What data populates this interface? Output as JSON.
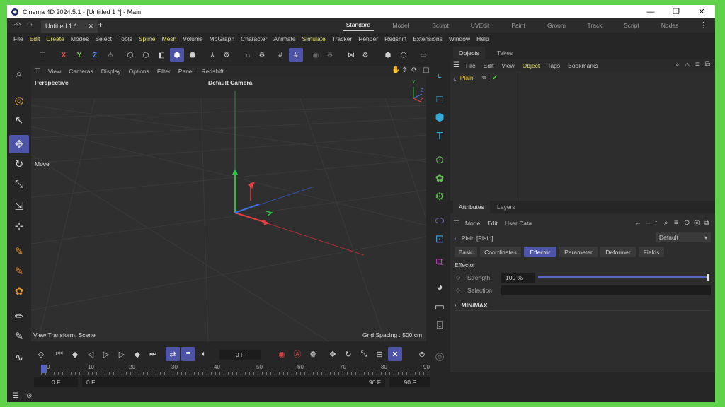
{
  "window": {
    "title": "Cinema 4D 2024.5.1 - [Untitled 1 *] - Main",
    "controls": {
      "minimize": "—",
      "maximize": "❐",
      "close": "✕"
    }
  },
  "tabs": {
    "doc_tab": "Untitled 1 *",
    "close": "✕",
    "add": "+",
    "layouts": [
      "Standard",
      "Model",
      "Sculpt",
      "UVEdit",
      "Paint",
      "Groom",
      "Track",
      "Script",
      "Nodes"
    ],
    "active_layout": "Standard"
  },
  "menu": [
    "File",
    "Edit",
    "Create",
    "Modes",
    "Select",
    "Tools",
    "Spline",
    "Mesh",
    "Volume",
    "MoGraph",
    "Character",
    "Animate",
    "Simulate",
    "Tracker",
    "Render",
    "Redshift",
    "Extensions",
    "Window",
    "Help"
  ],
  "toolbar": {
    "x": "X",
    "y": "Y",
    "z": "Z"
  },
  "viewport": {
    "menu": [
      "View",
      "Cameras",
      "Display",
      "Options",
      "Filter",
      "Panel",
      "Redshift"
    ],
    "projection": "Perspective",
    "camera": "Default Camera",
    "tool": "Move",
    "view_transform": "View Transform: Scene",
    "grid_spacing": "Grid Spacing : 500 cm",
    "axis_y": "Y",
    "axis_z": "Z",
    "axis_x": "X"
  },
  "objects": {
    "tabs": [
      "Objects",
      "Takes"
    ],
    "menu": [
      "File",
      "Edit",
      "View",
      "Object",
      "Tags",
      "Bookmarks"
    ],
    "active_menu": "Object",
    "items": [
      {
        "name": "Plain"
      }
    ]
  },
  "attributes": {
    "tabs": [
      "Attributes",
      "Layers"
    ],
    "menu": [
      "Mode",
      "Edit",
      "User Data"
    ],
    "object_label": "Plain [Plain]",
    "preset": "Default",
    "buttons": [
      "Basic",
      "Coordinates",
      "Effector",
      "Parameter",
      "Deformer",
      "Fields"
    ],
    "active_button": "Effector",
    "section": "Effector",
    "strength_label": "Strength",
    "strength_value": "100 %",
    "strength_fraction": 1.0,
    "selection_label": "Selection",
    "group": "MIN/MAX"
  },
  "timeline": {
    "current_frame": "0 F",
    "ruler_ticks": [
      "0",
      "10",
      "20",
      "30",
      "40",
      "50",
      "60",
      "70",
      "80",
      "90"
    ],
    "start": "0 F",
    "preview_start": "0 F",
    "preview_end": "90 F",
    "end": "90 F"
  }
}
